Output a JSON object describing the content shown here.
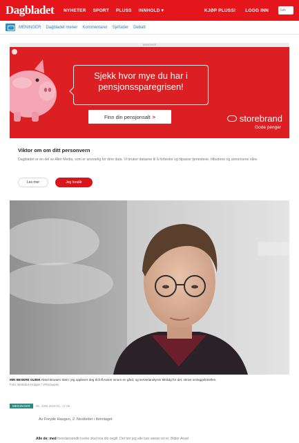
{
  "header": {
    "logo": "Dagbladet",
    "nav": [
      "NYHETER",
      "SPORT",
      "PLUSS",
      "INNHOLD ▾"
    ],
    "right": [
      "KJØP PLUSS!",
      "LOGG INN"
    ],
    "search_placeholder": "Søk",
    "color": "#e4161b"
  },
  "subnav": {
    "links": [
      "MENINGER",
      "Dagbladet mener",
      "Kommentarer",
      "Sjefsider",
      "Debatt"
    ]
  },
  "ad": {
    "label": "ANNONSE",
    "headline": "Sjekk hvor mye du har i pensjonssparegrisen!",
    "cta": "Finn din pensjonsalt",
    "cta_arrow": ">",
    "brand": "storebrand",
    "brand_sub": "Gode penger",
    "color": "#dc1f22"
  },
  "privacy": {
    "title": "Viktor om om ditt personvern",
    "text": "Dagbladet er en del av Aller Media, som er ansvarlig for dine data. Vi bruker dataene til å forbedre og tilpasse tjenestene, tilbudene og annonsene våre.",
    "btn_more": "Les mer",
    "btn_accept": "Jeg forstår"
  },
  "article": {
    "caption_bold": "MIN BESERE GUIDE",
    "caption": "Aksel Braaten Stein: jeg opplever deg til å få tusen innom en gård, og serverlandtyner tiltrådg for det, skrive innleggsfortellen.",
    "credit": "Foto: Bertebus Hopper / VRSnaxpilo",
    "tag": "MENINGER",
    "date": "05. JUNI 2019 KL. 17:35",
    "author": "Av Freyde Haugen, 2. Nestleder i Ibinnlaget",
    "lede_bold": "Alle de: med",
    "lede": "hvordansendtt kveler skal hva din negill. Det her jeg alle kan væran en er. Bilder Aksel"
  }
}
